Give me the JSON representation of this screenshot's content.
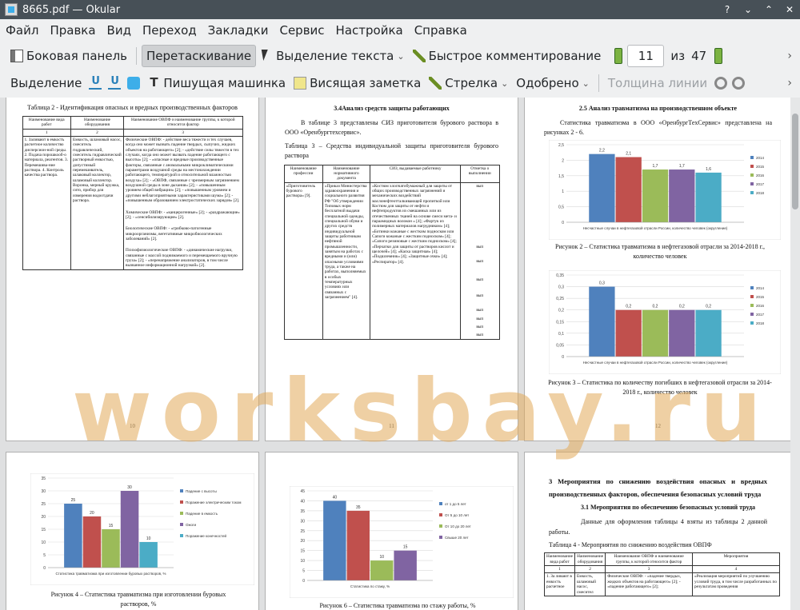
{
  "window": {
    "title": "8665.pdf — Okular"
  },
  "menu": [
    "Файл",
    "Правка",
    "Вид",
    "Переход",
    "Закладки",
    "Сервис",
    "Настройка",
    "Справка"
  ],
  "toolbar1": {
    "sidebar": "Боковая панель",
    "drag": "Перетаскивание",
    "select_text": "Выделение текста",
    "quick_comment": "Быстрое комментирование",
    "page_current": "11",
    "page_of": "из",
    "page_total": "47"
  },
  "toolbar2": {
    "highlight": "Выделение",
    "typewriter": "Пишущая машинка",
    "hanging_note": "Висящая заметка",
    "arrow": "Стрелка",
    "approved": "Одобрено",
    "line_width": "Толщина линии"
  },
  "watermark": "worksbay.ru",
  "pages": {
    "p10": {
      "caption": "Таблица 2 - Идентификация опасных и вредных производственных факторов",
      "headers": [
        "Наименование вида работ",
        "Наименование оборудования",
        "Наименование ОВПФ и наименование группы, к которой относится фактор"
      ],
      "nums": [
        "1",
        "2",
        "3"
      ],
      "col1": "1. Заливают в емкость расчетное количество дисперсион-ной среды. 2. Подача порошкооб-о материала, реагентов. 3. Перемешива-ние раствора. 4. Контроль качества раствора.",
      "col2": "Емкость, шламовый насос, смеситель гидравлический, смеситель гидравлический растворный емкостью, допустимый перемешиватель, шлаковый коллектор, шламовый коллектор. Воронка, мерный кружка, сито, прибор для измерения водоотдачи раствора.",
      "col3a": "Физические ОВПФ: - действие веса тяжести и тех случаев, когда оно может вызвать падение твердых, сыпучих, жидких объектов на работающего» [2]; - «действие силы тяжести в тех случаях, когда оно может вызвать падение работающего с высоты» [2]; - «опасные и вредные производственные факторы, связанные с аномальными микроклиматическими параметрами воздушной среды на местонахождении работающего, температурой и относительной влажностью воздуха» [2]; - «ОВПФ, связанные с чрезмерным загрязнением воздушной среды в зоне дыхания» [2]; - «повышенным уровнем общей вибрации» [2]; - «повышенным уровнем и другими неблагоприятными характеристиками шума» [2]; - «повышенным образованием электростатических зарядов» [2].",
      "col3b": "Химические ОВПФ: - «канцерогенные» [2]; - «раздражающие» [2]; - «сенсибилизирующие» [2].",
      "col3c": "Биологические ОВПФ: - «грибково-патогенные микроорганизмы, вегетативные микробиологических заболеваний» [2].",
      "col3d": "Психофизиологические ОВПФ: - «динамические нагрузки, связанные с массой поднимаемого и перемещаемого вручную груза» [2]; - «перенапряжение анализаторов, в том числе вызванное информационной нагрузкой» [2].",
      "page_no": "10"
    },
    "p11": {
      "heading": "3.4Анализ средств защиты работающих",
      "intro": "В таблице 3 представлены СИЗ приготовителя бурового раствора в ООО «Оренбургтехсервис».",
      "caption": "Таблица 3 – Средства индивидуальной защиты приготовителя бурового раствора",
      "headers": [
        "Наименование профессии",
        "Наименование нормативного документа",
        "СИЗ, выдаваемые работнику",
        "Отметка о выполнении"
      ],
      "profession": "«Приготовитель бурового раствора» [9].",
      "document": "«Приказ Министерства здравоохранения и социального развития РФ \"Об утверждении Типовых норм бесплатной выдачи специальной одежды, специальной обуви и других средств индивидуальной защиты работникам нефтяной промышленности, занятым на работах с вредными и (или) опасными условиями труда, а также на работах, выполняемых в особых температурных условиях или связанных с загрязнением\" [4].",
      "siz": "«Костюм хлопчатобумажный для защиты от общих производственных загрязнений и механических воздействий маслонефтеотталкивающей пропиткой или Костюм для защиты от нефти и нефтепродуктов из смешанных или из отечественных тканей на основе смеси мета- и параамидных волокон » [4]; «Фартук из полимерных материалов нагрудником» [4]; «Ботинки кожаные с жестким подноском или Сапоги кожаные с жестким подноском» [4]; «Сапоги резиновые с жестким подноском» [4]; «Перчатки для защиты от растворов кислот и щелочей» [4]; «Каска защитная» [4]; «Подшлемник» [4]; «Защитные очки» [4]; «Респиратор» [4].",
      "marks": [
        "вып",
        "вып",
        "вып",
        "вып",
        "вып",
        "вып",
        "вып",
        "вып",
        "вып"
      ],
      "page_no": "11"
    },
    "p12": {
      "heading": "2.5 Анализ травматизма на производственном объекте",
      "intro": "Статистика травматизма в ООО «ОренбургТехСервис» представлена на рисунках 2 - 6.",
      "fig2_caption": "Рисунок 2 – Статистика травматизма в нефтегазовой отрасли за 2014-2018 г., количество человек",
      "fig3_caption": "Рисунок 3 – Статистика по количеству погибших в нефтегазовой отрасли за 2014-2018 г., количество человек",
      "page_no": "12"
    },
    "p13": {
      "fig4_caption": "Рисунок 4 – Статистика травматизма при изготовлении буровых растворов, %"
    },
    "p14": {
      "fig6_caption": "Рисунок 6 – Статистика травматизма по стажу работы, %"
    },
    "p15": {
      "heading": "3 Мероприятия по снижению воздействия опасных и вредных производственных факторов, обеспечения безопасных условий труда",
      "sub": "3.1 Мероприятия по обеспечению безопасных условий труда",
      "intro": "Данные для оформления таблицы 4 взяты из таблицы 2 данной работы.",
      "caption": "Таблица 4 - Мероприятия по снижению воздействия ОВПФ",
      "headers": [
        "Наименование вида работ",
        "Наименование оборудования",
        "Наименование ОВПФ и наименование группы, к которой относится фактор",
        "Мероприятия"
      ],
      "nums": [
        "1",
        "2",
        "3",
        "4"
      ],
      "r1": [
        "1. За ливают в емкость расчетное",
        "Емкость, шламовый насос, смесител",
        "Физические ОВПФ: - «падение твердых, жидких объектов на работающего» [2]; - «падение работающего» [2];",
        "«Реализация мероприятий по улучшению условий труда, в том числе разработанных по результатам проведения"
      ]
    }
  },
  "chart_data": [
    {
      "type": "bar",
      "title": "",
      "categories": [
        "Несчастные случаи в нефтегазовой отрасли России, количество человек (округление)"
      ],
      "series": [
        {
          "name": "2014",
          "values": [
            2.2
          ],
          "color": "#4f81bd"
        },
        {
          "name": "2015",
          "values": [
            2.1
          ],
          "color": "#c0504d"
        },
        {
          "name": "2016",
          "values": [
            1.7
          ],
          "color": "#9bbb59"
        },
        {
          "name": "2017",
          "values": [
            1.7
          ],
          "color": "#8064a2"
        },
        {
          "name": "2018",
          "values": [
            1.6
          ],
          "color": "#4bacc6"
        }
      ],
      "ylim": [
        0,
        2.5
      ],
      "yticks": [
        "0",
        "0,5",
        "1",
        "1,5",
        "2",
        "2,5"
      ],
      "value_labels": [
        "2,2",
        "2,1",
        "1,7",
        "1,7",
        "1,6"
      ],
      "legend": "right"
    },
    {
      "type": "bar",
      "title": "",
      "categories": [
        "Несчастные случаи в нефтегазовой отрасли России, количество человек (округление)"
      ],
      "series": [
        {
          "name": "2014",
          "values": [
            0.3
          ],
          "color": "#4f81bd"
        },
        {
          "name": "2015",
          "values": [
            0.2
          ],
          "color": "#c0504d"
        },
        {
          "name": "2016",
          "values": [
            0.2
          ],
          "color": "#9bbb59"
        },
        {
          "name": "2017",
          "values": [
            0.2
          ],
          "color": "#8064a2"
        },
        {
          "name": "2018",
          "values": [
            0.2
          ],
          "color": "#4bacc6"
        }
      ],
      "ylim": [
        0,
        0.35
      ],
      "yticks": [
        "0",
        "0,05",
        "0,1",
        "0,15",
        "0,2",
        "0,25",
        "0,3",
        "0,35"
      ],
      "value_labels": [
        "0,3",
        "0,2",
        "0,2",
        "0,2",
        "0,2"
      ],
      "legend": "right"
    },
    {
      "type": "bar",
      "title": "",
      "categories": [
        "Статистика травматизма при изготовлении буровых растворов, %"
      ],
      "series": [
        {
          "name": "Падение с высоты",
          "values": [
            25
          ],
          "color": "#4f81bd"
        },
        {
          "name": "Поражение электрическим током",
          "values": [
            20
          ],
          "color": "#c0504d"
        },
        {
          "name": "Падение в емкость",
          "values": [
            15
          ],
          "color": "#9bbb59"
        },
        {
          "name": "Ожоги",
          "values": [
            30
          ],
          "color": "#8064a2"
        },
        {
          "name": "Поражение конечностей",
          "values": [
            10
          ],
          "color": "#4bacc6"
        }
      ],
      "ylim": [
        0,
        35
      ],
      "yticks": [
        "0",
        "5",
        "10",
        "15",
        "20",
        "25",
        "30",
        "35"
      ],
      "value_labels": [
        "25",
        "20",
        "15",
        "30",
        "10"
      ],
      "legend": "right"
    },
    {
      "type": "bar",
      "title": "",
      "categories": [
        "Статистика по стажу, %"
      ],
      "series": [
        {
          "name": "от 1 до 5 лет",
          "values": [
            40
          ],
          "color": "#4f81bd"
        },
        {
          "name": "От 5 до 10 лет",
          "values": [
            35
          ],
          "color": "#c0504d"
        },
        {
          "name": "От 10 до 20 лет",
          "values": [
            10
          ],
          "color": "#9bbb59"
        },
        {
          "name": "Свыше 20 лет",
          "values": [
            15
          ],
          "color": "#8064a2"
        }
      ],
      "ylim": [
        0,
        45
      ],
      "yticks": [
        "0",
        "5",
        "10",
        "15",
        "20",
        "25",
        "30",
        "35",
        "40",
        "45"
      ],
      "value_labels": [
        "40",
        "35",
        "10",
        "15"
      ],
      "legend": "right"
    }
  ]
}
